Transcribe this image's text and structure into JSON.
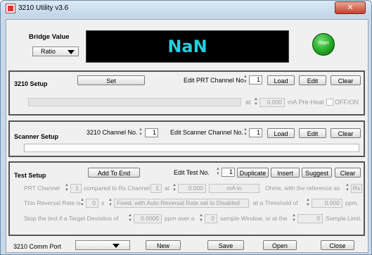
{
  "window": {
    "title": "3210 Utility v3.6",
    "close_glyph": "✕"
  },
  "bridge": {
    "label": "Bridge Value",
    "mode_selected": "Ratio",
    "display_value": "NaN",
    "start_label": "Start",
    "start_color": "#22aa22",
    "display_color": "#22cfe0"
  },
  "setup3210": {
    "title": "3210 Setup",
    "set_label": "Set",
    "edit_prt_label": "Edit PRT Channel No.",
    "prt_channel": "1",
    "load_label": "Load",
    "edit_label": "Edit",
    "clear_label": "Clear",
    "at_label": "at",
    "preheat_value": "0.000",
    "preheat_unit": "mA Pre-Heat",
    "off_on_label": "OFF/ON"
  },
  "scanner": {
    "title": "Scanner Setup",
    "channel_label": "3210 Channel No.",
    "channel_value": "1",
    "edit_label": "Edit Scanner Channel No.",
    "edit_value": "1",
    "load_label": "Load",
    "edit_btn_label": "Edit",
    "clear_label": "Clear"
  },
  "test": {
    "title": "Test Setup",
    "add_label": "Add To End",
    "edit_test_label": "Edit Test No.",
    "test_no": "1",
    "duplicate_label": "Duplicate",
    "insert_label": "Insert",
    "suggest_label": "Suggest",
    "clear_label": "Clear",
    "row1": {
      "prt_label": "PRT Channel",
      "prt_value": "1",
      "compared_label": "compared to Rs Channel",
      "rs_value": "1",
      "at_label": "at",
      "current_value": "0.000",
      "current_unit": "mA in",
      "ohms_label": "Ohms, with the reference as",
      "ref_value": "Rs"
    },
    "row2": {
      "reversal_label": "This Reversal Rate is",
      "rate_value": "0",
      "s_label": "s",
      "fixed_text": "Fixed, with Auto Reversal Rate set to Disabled",
      "threshold_label": "at a Threshold of",
      "threshold_value": "0.000",
      "ppm_label": "ppm."
    },
    "row3": {
      "stop_label": "Stop the test if a Target Deviation of",
      "deviation_value": "0.0000",
      "ppm_over_label": "ppm over a",
      "window_value": "0",
      "window_label": "sample Window, or at the",
      "limit_value": "0",
      "limit_label": "Sample Limit."
    }
  },
  "footer": {
    "comm_label": "3210 Comm Port",
    "comm_selected": "",
    "new_label": "New",
    "save_label": "Save",
    "open_label": "Open",
    "close_label": "Close"
  }
}
